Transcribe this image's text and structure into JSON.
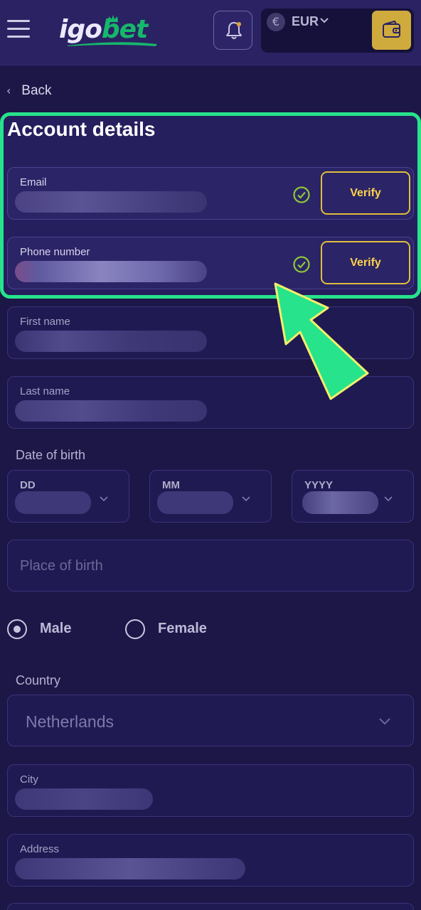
{
  "header": {
    "logo_part1": "igo",
    "logo_part2": "bet",
    "currency_symbol": "€",
    "currency": "EUR",
    "icons": [
      "hamburger-icon",
      "bell-icon",
      "chevron-down-icon",
      "wallet-icon"
    ]
  },
  "nav": {
    "back_label": "Back"
  },
  "account": {
    "title": "Account details",
    "email_label": "Email",
    "email_value": "hidden",
    "email_verify": "Verify",
    "phone_label": "Phone number",
    "phone_value": "hidden",
    "phone_verify": "Verify"
  },
  "form": {
    "first_name_label": "First name",
    "last_name_label": "Last name",
    "dob_label": "Date of birth",
    "dob_day_label": "DD",
    "dob_month_label": "MM",
    "dob_year_label": "YYYY",
    "place_placeholder": "Place of birth",
    "gender_male": "Male",
    "gender_female": "Female",
    "country_label": "Country",
    "country_value": "Netherlands",
    "city_label": "City",
    "address_label": "Address"
  },
  "colors": {
    "background": "#1c1747",
    "header": "#2a2263",
    "highlight": "#27e38b",
    "verify": "#e1be3d",
    "wallet": "#cfab3d",
    "check": "#8fc63b"
  }
}
